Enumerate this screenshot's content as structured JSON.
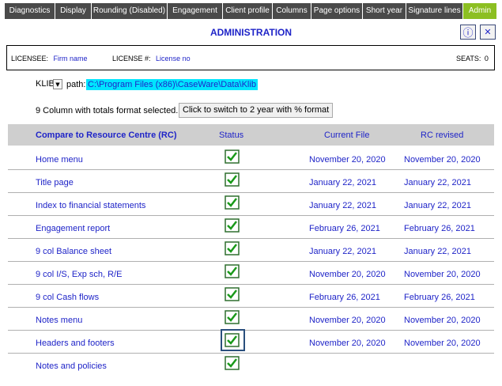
{
  "tabs": [
    {
      "label": "Diagnostics",
      "active": false
    },
    {
      "label": "Display",
      "active": false
    },
    {
      "label": "Rounding (Disabled)",
      "active": false
    },
    {
      "label": "Engagement",
      "active": false
    },
    {
      "label": "Client profile",
      "active": false
    },
    {
      "label": "Columns",
      "active": false
    },
    {
      "label": "Page options",
      "active": false
    },
    {
      "label": "Short year",
      "active": false
    },
    {
      "label": "Signature lines",
      "active": false
    },
    {
      "label": "Admin",
      "active": true
    }
  ],
  "title": "ADMINISTRATION",
  "info_glyph": "ⓘ",
  "close_glyph": "✕",
  "licensee_label": "LICENSEE:",
  "licensee_value": "Firm name",
  "license_label": "LICENSE #:",
  "license_value": "License no",
  "seats_label": "SEATS:",
  "seats_value": "0",
  "klib_label": "KLIB",
  "klib_dropdown_glyph": "▼",
  "path_label": "path:",
  "path_value": "C:\\Program Files (x86)\\CaseWare\\Data\\Klib",
  "format_text": "9 Column with totals format selected.",
  "format_button": "Click to switch to 2 year with % format",
  "table": {
    "headers": {
      "name": "Compare to Resource Centre (RC)",
      "status": "Status",
      "current": "Current File",
      "rc": "RC revised"
    },
    "rows": [
      {
        "name": "Home menu",
        "current": "November 20, 2020",
        "rc": "November 20, 2020",
        "checked": true
      },
      {
        "name": "Title page",
        "current": "January 22, 2021",
        "rc": "January 22, 2021",
        "checked": true
      },
      {
        "name": "Index to financial statements",
        "current": "January 22, 2021",
        "rc": "January 22, 2021",
        "checked": true
      },
      {
        "name": "Engagement report",
        "current": "February 26, 2021",
        "rc": "February 26, 2021",
        "checked": true
      },
      {
        "name": "9 col Balance sheet",
        "current": "January 22, 2021",
        "rc": "January 22, 2021",
        "checked": true
      },
      {
        "name": "9 col I/S, Exp sch, R/E",
        "current": "November 20, 2020",
        "rc": "November 20, 2020",
        "checked": true
      },
      {
        "name": "9 col Cash flows",
        "current": "February 26, 2021",
        "rc": "February 26, 2021",
        "checked": true
      },
      {
        "name": "Notes menu",
        "current": "November 20, 2020",
        "rc": "November 20, 2020",
        "checked": true
      },
      {
        "name": "Headers and footers",
        "current": "November 20, 2020",
        "rc": "November 20, 2020",
        "checked": true,
        "focused": true
      },
      {
        "name": "Notes and policies",
        "current": "",
        "rc": "",
        "checked": true
      }
    ]
  },
  "colors": {
    "tab_bg": "#4a4a4a",
    "tab_active": "#8cbf22",
    "accent_blue": "#1f24c8",
    "path_highlight": "#00e5ff",
    "header_bg": "#cfcfcf",
    "check_green": "#1a9a1a"
  }
}
